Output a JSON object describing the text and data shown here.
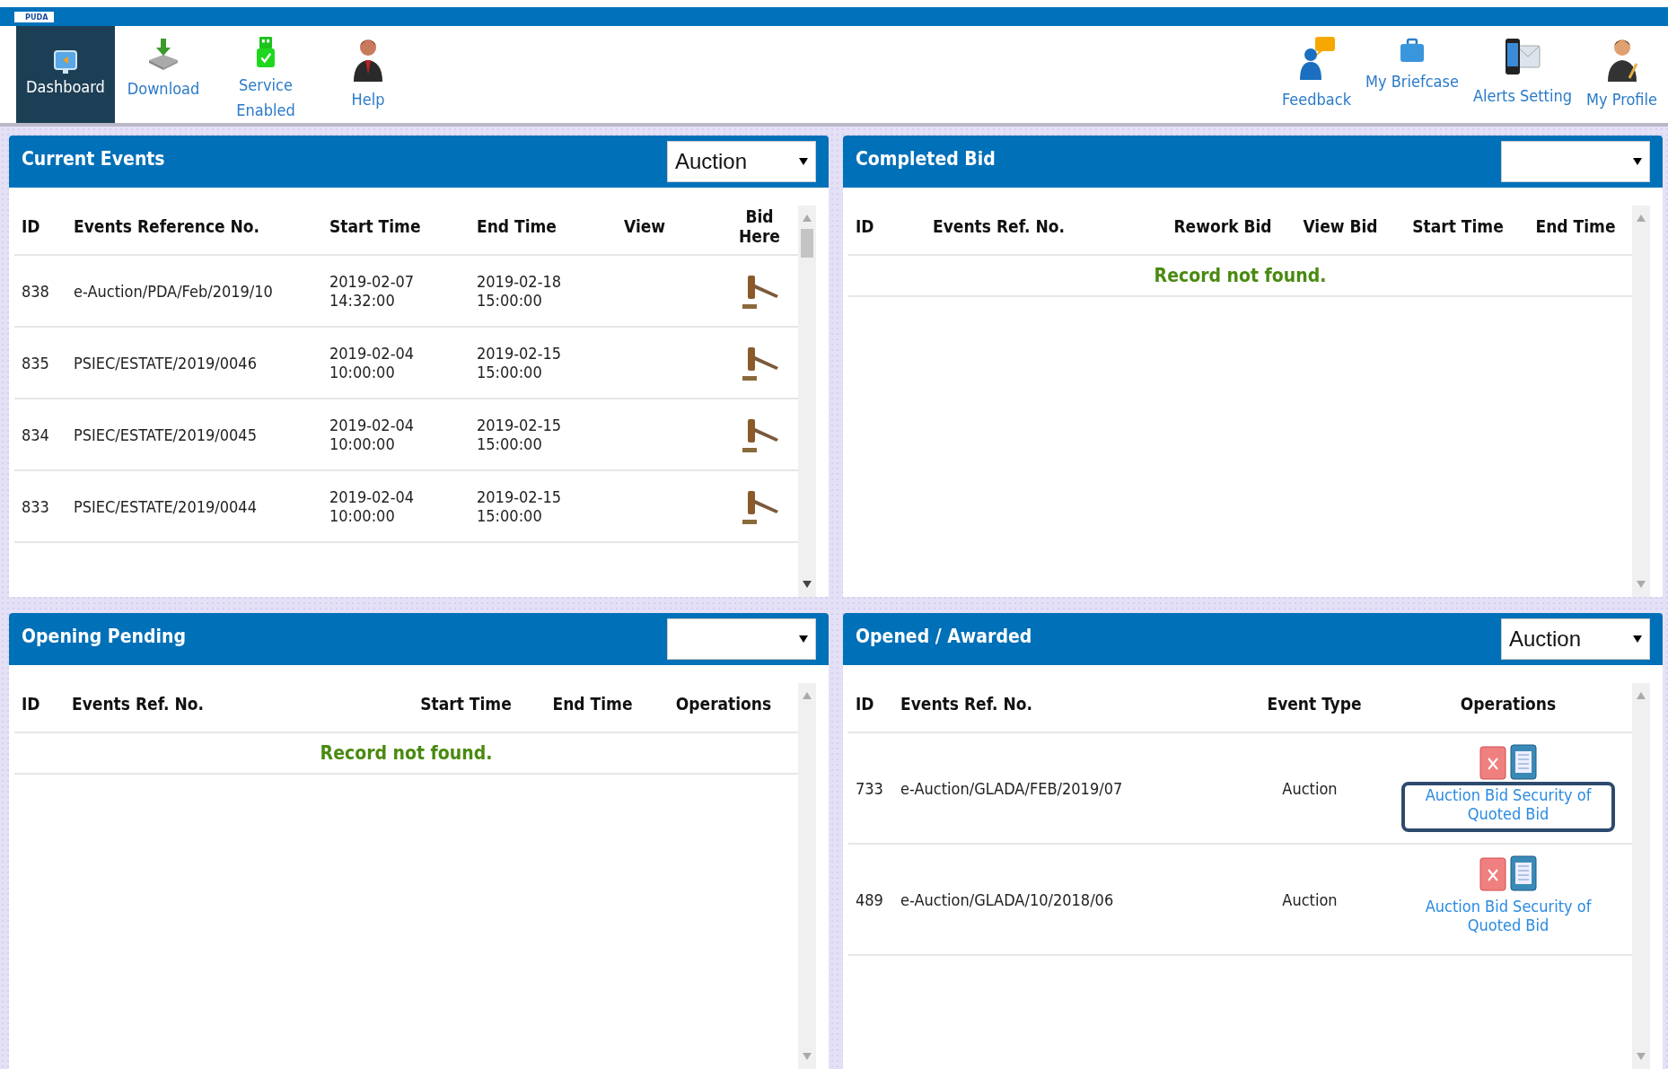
{
  "logo": "PUDA",
  "toolbar": {
    "left": [
      {
        "kind": "dashboard",
        "label": "Dashboard",
        "selected": true
      },
      {
        "kind": "download",
        "label": "Download",
        "selected": false
      },
      {
        "kind": "service",
        "label": "Service Enabled",
        "selected": false
      },
      {
        "kind": "help",
        "label": "Help",
        "selected": false
      }
    ],
    "right": [
      {
        "kind": "feedback",
        "label": "Feedback",
        "selected": false
      },
      {
        "kind": "briefcase",
        "label": "My Briefcase",
        "selected": false
      },
      {
        "kind": "alerts",
        "label": "Alerts Setting",
        "selected": false
      },
      {
        "kind": "profile",
        "label": "My Profile",
        "selected": false
      }
    ]
  },
  "panels": [
    {
      "kind": "current",
      "title": "Current Events",
      "filter": {
        "value": "Auction"
      },
      "columns": [
        "ID",
        "Events Reference No.",
        "Start Time",
        "End Time",
        "View",
        "Bid Here"
      ],
      "rows": [
        {
          "cells": [
            "838",
            "e-Auction/PDA/Feb/2019/10",
            "2019-02-07 14:32:00",
            "2019-02-18 15:00:00"
          ]
        },
        {
          "cells": [
            "835",
            "PSIEC/ESTATE/2019/0046",
            "2019-02-04 10:00:00",
            "2019-02-15 15:00:00"
          ]
        },
        {
          "cells": [
            "834",
            "PSIEC/ESTATE/2019/0045",
            "2019-02-04 10:00:00",
            "2019-02-15 15:00:00"
          ]
        },
        {
          "cells": [
            "833",
            "PSIEC/ESTATE/2019/0044",
            "2019-02-04 10:00:00",
            "2019-02-15 15:00:00"
          ]
        }
      ]
    },
    {
      "kind": "completed",
      "title": "Completed Bid",
      "columns": [
        "ID",
        "Events Ref. No.",
        "Rework Bid",
        "View Bid",
        "Start Time",
        "End Time"
      ],
      "empty_message": "Record not found."
    },
    {
      "kind": "pending",
      "title": "Opening Pending",
      "columns": [
        "ID",
        "Events Ref. No.",
        "Start Time",
        "End Time",
        "Operations"
      ],
      "empty_message": "Record not found."
    },
    {
      "kind": "awarded",
      "title": "Opened / Awarded",
      "filter": {
        "value": "Auction"
      },
      "columns": [
        "ID",
        "Events Ref. No.",
        "Event Type",
        "Operations"
      ],
      "rows": [
        {
          "cells": [
            "733",
            "e-Auction/GLADA/FEB/2019/07",
            "Auction"
          ],
          "link": "Auction Bid Security of Quoted Bid",
          "highlighted": true
        },
        {
          "cells": [
            "489",
            "e-Auction/GLADA/10/2018/06",
            "Auction"
          ],
          "link": "Auction Bid Security of Quoted Bid",
          "highlighted": false
        }
      ]
    }
  ]
}
